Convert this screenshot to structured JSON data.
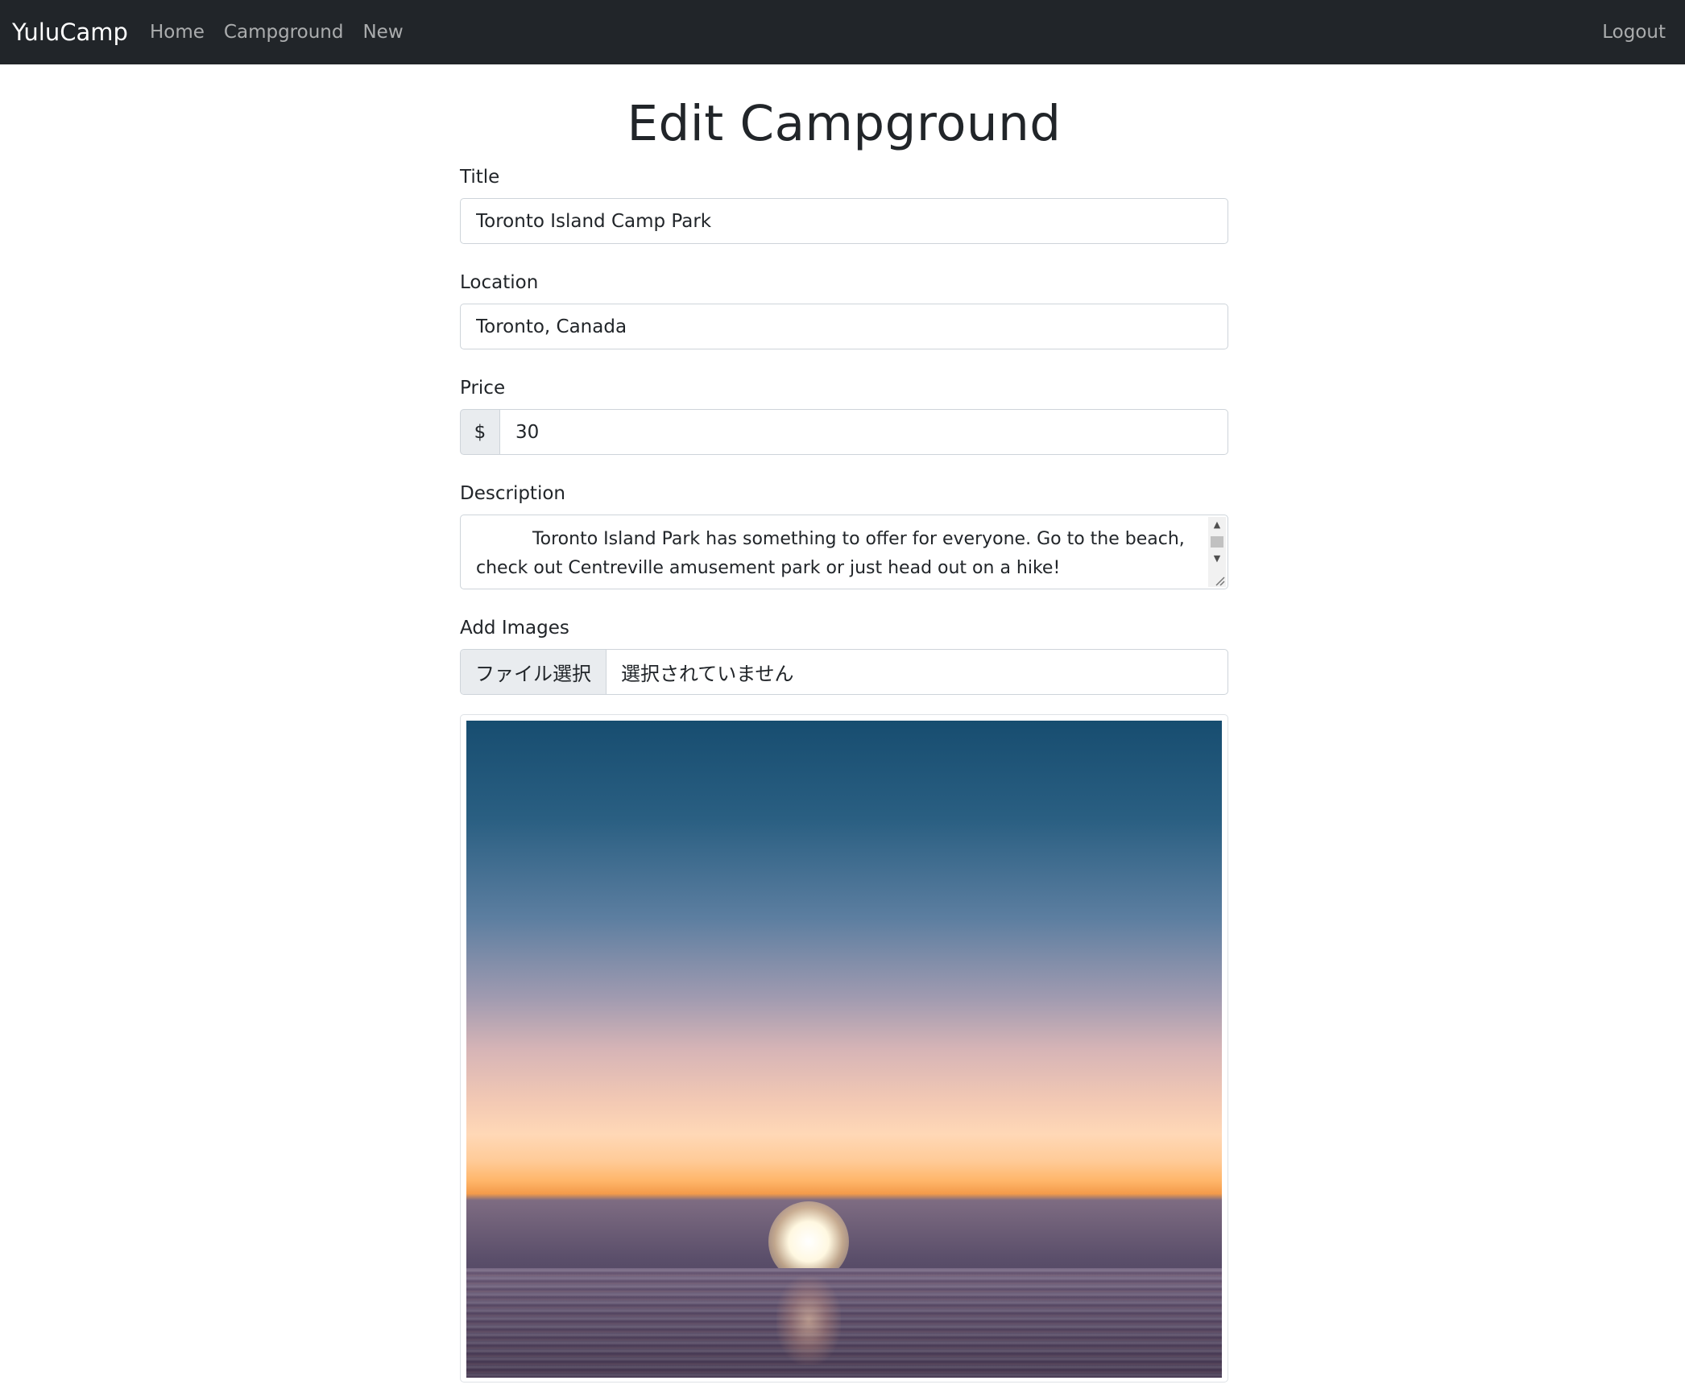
{
  "navbar": {
    "brand": "YuluCamp",
    "links": [
      "Home",
      "Campground",
      "New"
    ],
    "right_link": "Logout",
    "bg_color": "#212529"
  },
  "page": {
    "title": "Edit Campground"
  },
  "form": {
    "title_label": "Title",
    "title_value": "Toronto Island Camp Park",
    "location_label": "Location",
    "location_value": "Toronto, Canada",
    "price_label": "Price",
    "price_prefix": "$",
    "price_value": "30",
    "description_label": "Description",
    "description_value": "          Toronto Island Park has something to offer for everyone. Go to the beach, check out Centreville amusement park or just head out on a hike!",
    "images_label": "Add Images",
    "file_button_label": "ファイル選択",
    "file_status": "選択されていません"
  },
  "image": {
    "icon": "sunset-over-sea-image"
  },
  "colors": {
    "border": "#ced4da",
    "input_group_bg": "#e9ecef",
    "text": "#212529"
  }
}
